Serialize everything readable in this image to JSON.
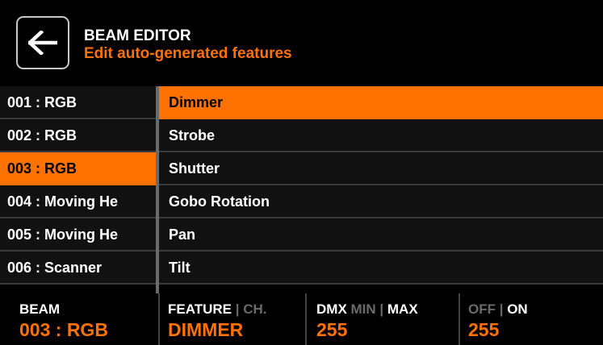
{
  "header": {
    "title": "BEAM EDITOR",
    "subtitle": "Edit auto-generated features"
  },
  "beams": [
    {
      "label": "001 : RGB",
      "selected": false
    },
    {
      "label": "002 : RGB",
      "selected": false
    },
    {
      "label": "003 : RGB",
      "selected": true
    },
    {
      "label": "004 : Moving He",
      "selected": false
    },
    {
      "label": "005 : Moving He",
      "selected": false
    },
    {
      "label": "006 : Scanner",
      "selected": false
    }
  ],
  "features": [
    {
      "label": "Dimmer",
      "selected": true
    },
    {
      "label": "Strobe",
      "selected": false
    },
    {
      "label": "Shutter",
      "selected": false
    },
    {
      "label": "Gobo Rotation",
      "selected": false
    },
    {
      "label": "Pan",
      "selected": false
    },
    {
      "label": "Tilt",
      "selected": false
    }
  ],
  "footer": {
    "beam_label": "BEAM",
    "beam_value": "003 : RGB",
    "feature_label": "FEATURE",
    "ch_label": "CH.",
    "feature_value": "DIMMER",
    "dmx_label": "DMX",
    "min_label": "MIN",
    "max_label": "MAX",
    "dmx_value": "255",
    "off_label": "OFF",
    "on_label": "ON",
    "on_value": "255"
  },
  "colors": {
    "accent": "#ff7200",
    "row_bg": "#111111",
    "divider": "#6a6a6a",
    "muted_text": "#6a6a6a"
  },
  "icons": {
    "back": "arrow-left-icon"
  }
}
